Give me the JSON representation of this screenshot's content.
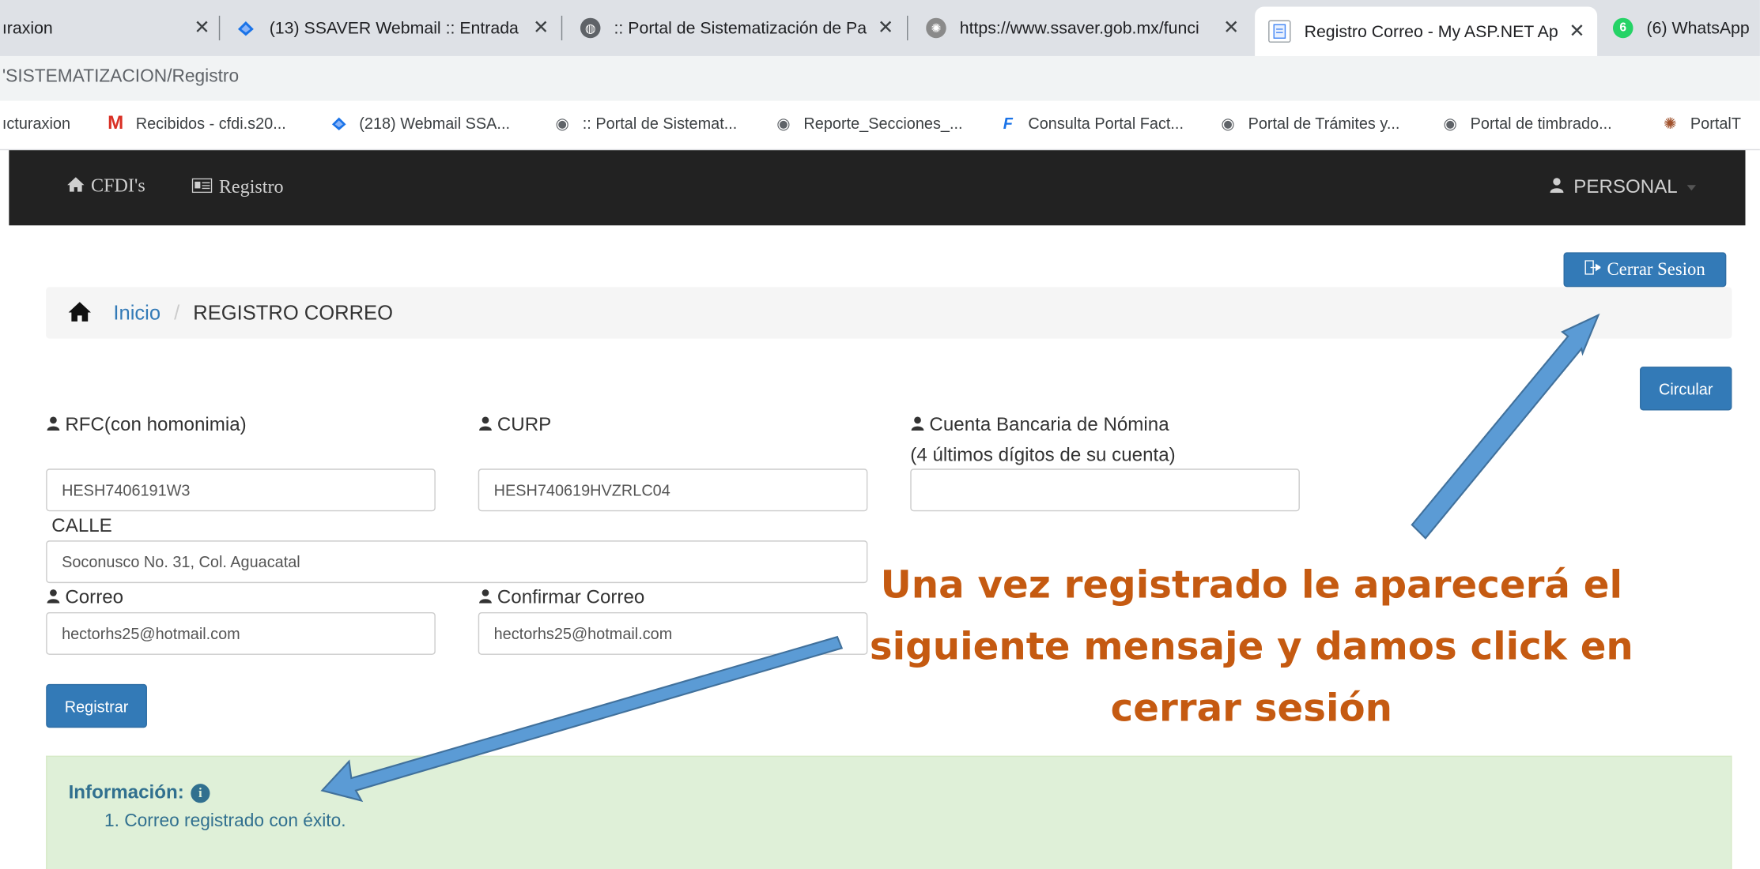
{
  "browser": {
    "tabs": [
      {
        "label": "ıraxion",
        "icon": "generic-page-icon"
      },
      {
        "label": "(13) SSAVER Webmail :: Entrada",
        "icon": "webmail-icon"
      },
      {
        "label": ":: Portal de Sistematización de Pa",
        "icon": "globe-icon"
      },
      {
        "label": "https://www.ssaver.gob.mx/funci",
        "icon": "seal-icon"
      },
      {
        "label": "Registro Correo - My ASP.NET Ap",
        "icon": "document-icon",
        "active": true
      },
      {
        "label": "(6) WhatsApp",
        "icon": "whatsapp-icon",
        "badge": "6"
      }
    ],
    "url": "'SISTEMATIZACION/Registro",
    "bookmarks": [
      {
        "label": "ıcturaxion",
        "icon": "none"
      },
      {
        "label": "Recibidos - cfdi.s20...",
        "icon": "gmail-icon"
      },
      {
        "label": "(218) Webmail SSA...",
        "icon": "webmail-icon"
      },
      {
        "label": ":: Portal de Sistemat...",
        "icon": "globe-icon"
      },
      {
        "label": "Reporte_Secciones_...",
        "icon": "globe-icon"
      },
      {
        "label": "Consulta Portal Fact...",
        "icon": "f-icon"
      },
      {
        "label": "Portal de Trámites y...",
        "icon": "globe-icon"
      },
      {
        "label": "Portal de timbrado...",
        "icon": "globe-icon"
      },
      {
        "label": "PortalT",
        "icon": "seal-icon"
      }
    ]
  },
  "navbar": {
    "items": [
      {
        "label": "CFDI's",
        "icon": "home-icon"
      },
      {
        "label": "Registro",
        "icon": "id-card-icon"
      }
    ],
    "user_label": "PERSONAL"
  },
  "page": {
    "logout_label": "Cerrar Sesion",
    "breadcrumb": {
      "home": "Inicio",
      "sep": "/",
      "current": "REGISTRO CORREO"
    },
    "circular_label": "Circular",
    "form": {
      "rfc_label": "RFC(con homonimia)",
      "rfc_value": "HESH7406191W3",
      "curp_label": "CURP",
      "curp_value": "HESH740619HVZRLC04",
      "cuenta_label": "Cuenta Bancaria de Nómina",
      "cuenta_sublabel": "(4 últimos dígitos de su cuenta)",
      "cuenta_value": "",
      "calle_label": "CALLE",
      "calle_value": "Soconusco No. 31, Col. Aguacatal",
      "correo_label": "Correo",
      "correo_value": "hectorhs25@hotmail.com",
      "confirmar_label": "Confirmar Correo",
      "confirmar_value": "hectorhs25@hotmail.com",
      "submit_label": "Registrar"
    },
    "info": {
      "title": "Información:",
      "message": "1. Correo registrado con éxito."
    }
  },
  "annotation": {
    "lines": [
      "Una vez registrado le aparecerá el",
      "siguiente mensaje y damos click en",
      "cerrar sesión"
    ],
    "text_color": "#c55a11",
    "arrow_color": "#5b9bd5"
  },
  "colors": {
    "navbar_bg": "#222222",
    "primary": "#337ab7",
    "success_bg": "#dff0d8",
    "info_text": "#31708f"
  }
}
